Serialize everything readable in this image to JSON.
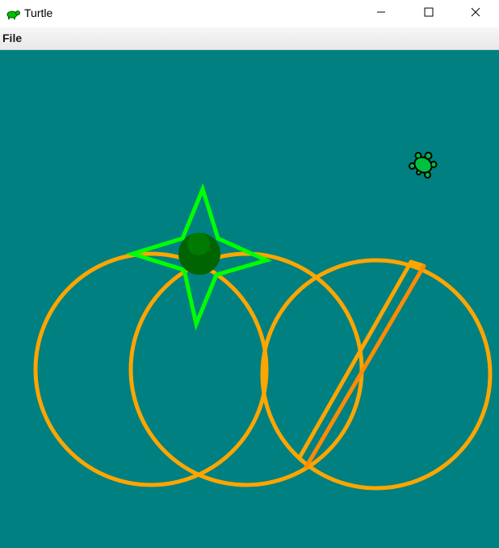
{
  "window": {
    "title": "Turtle",
    "app_icon": "turtle-icon",
    "controls": [
      "minimize-icon",
      "maximize-icon",
      "close-icon"
    ]
  },
  "menu": {
    "items": [
      {
        "label": "File"
      }
    ]
  },
  "canvas": {
    "background_color": "#008080",
    "stroke_colors": {
      "circles": "#ffa500",
      "diagonal_line_1": "#ffa500",
      "diagonal_line_2": "#ff8c00",
      "star": "#00ff00",
      "dot": "#006400",
      "dot_highlight": "#007a00",
      "turtle_fill": "#00c040",
      "turtle_outline": "#000000"
    },
    "shapes": [
      "circle",
      "circle",
      "circle",
      "line",
      "line",
      "star",
      "dot",
      "turtle-cursor"
    ]
  }
}
